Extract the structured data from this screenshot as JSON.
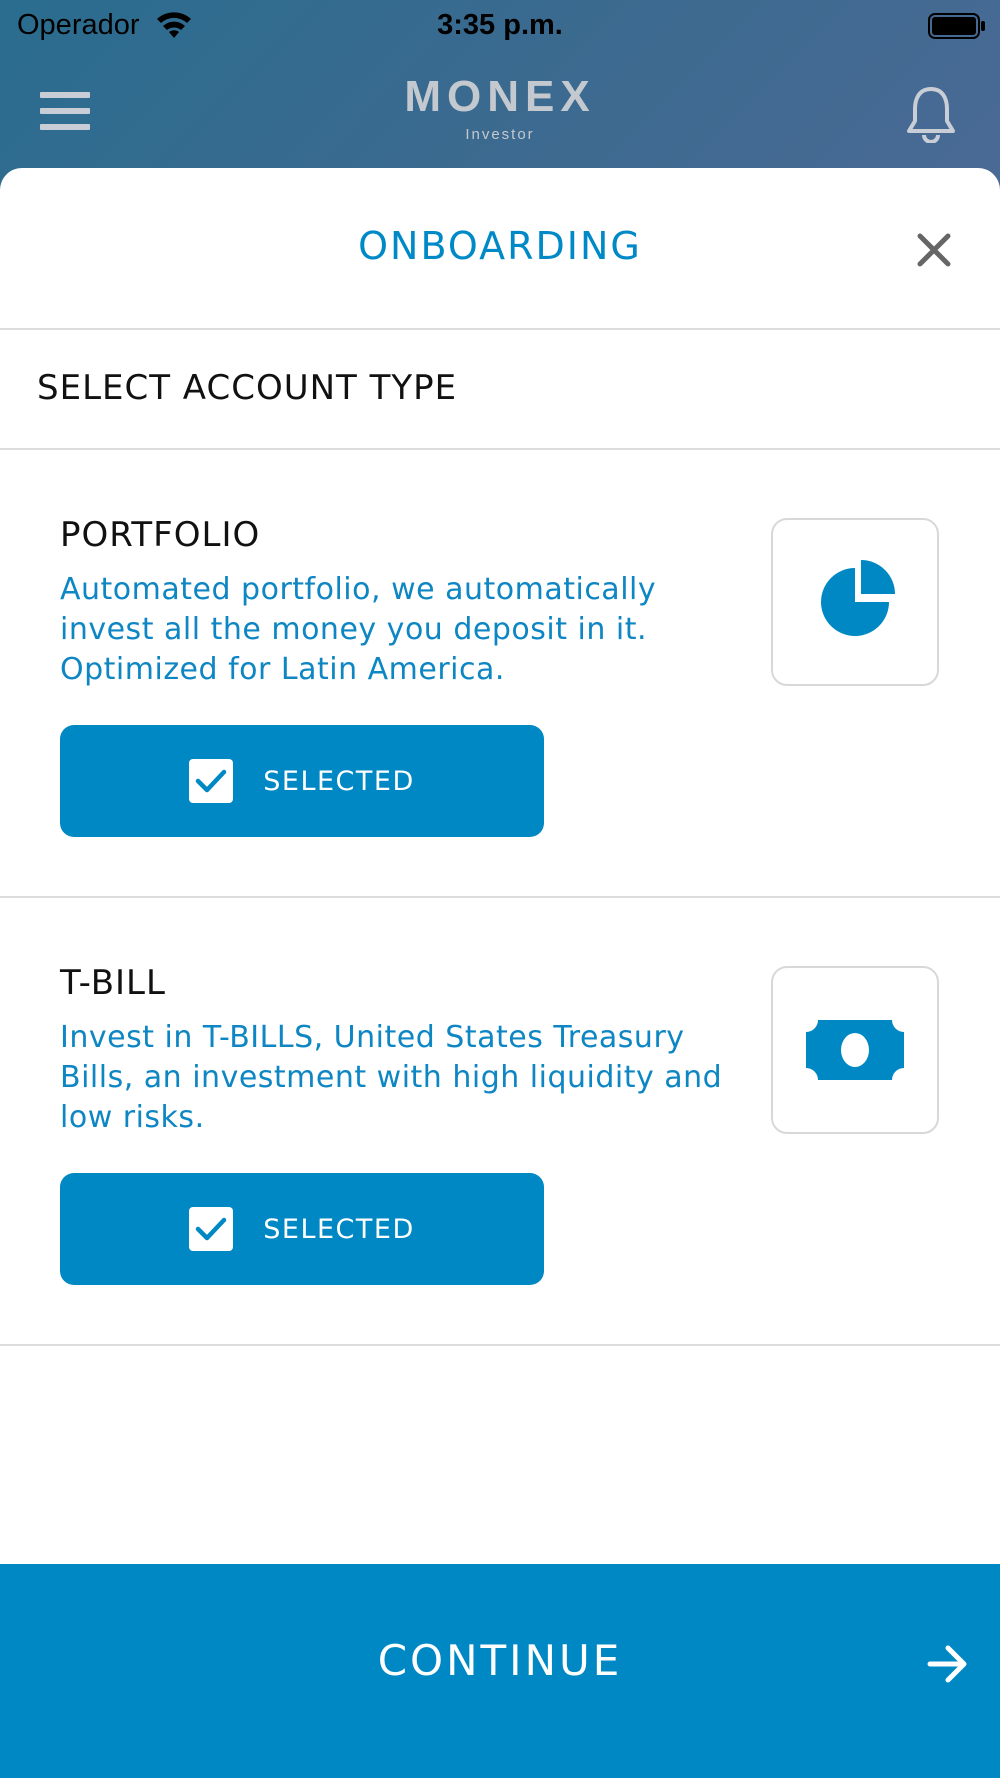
{
  "status_bar": {
    "carrier": "Operador",
    "time": "3:35 p.m."
  },
  "header": {
    "brand": "MONEX",
    "brand_sub": "Investor",
    "menu_icon": "hamburger-icon",
    "bell_icon": "bell-icon"
  },
  "sheet": {
    "title": "ONBOARDING",
    "close_icon": "close-icon"
  },
  "section": {
    "title": "SELECT ACCOUNT TYPE"
  },
  "options": [
    {
      "name": "PORTFOLIO",
      "description": "Automated portfolio, we automatically invest all the money you deposit in it. Optimized for Latin America.",
      "icon": "pie-chart-icon",
      "button_label": "SELECTED",
      "selected": true
    },
    {
      "name": "T-BILL",
      "description": "Invest in T-BILLS, United States Treasury Bills, an investment with high liquidity and low risks.",
      "icon": "money-bill-icon",
      "button_label": "SELECTED",
      "selected": true
    }
  ],
  "footer": {
    "continue_label": "CONTINUE",
    "arrow_icon": "arrow-right-icon"
  },
  "colors": {
    "accent": "#0088c4",
    "header_gradient_start": "#2a6d8f",
    "header_gradient_end": "#4a6a95"
  }
}
